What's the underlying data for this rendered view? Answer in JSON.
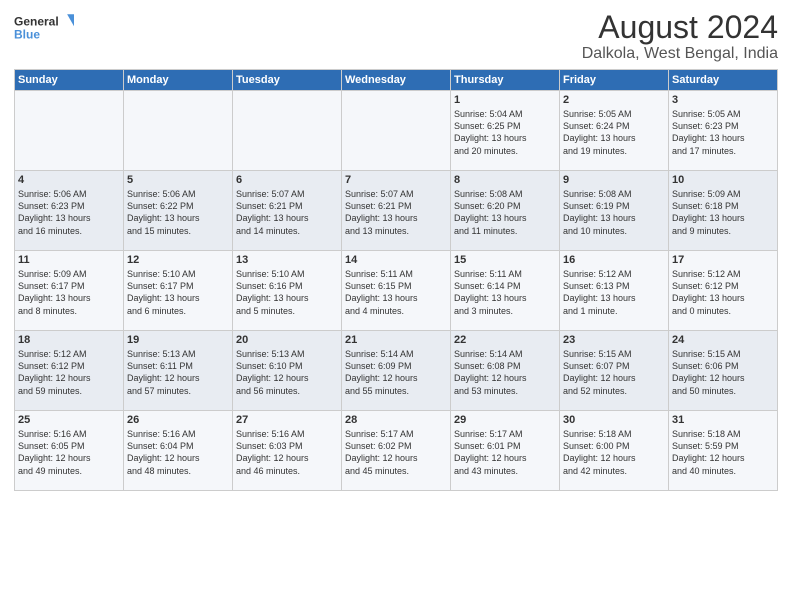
{
  "logo": {
    "line1": "General",
    "line2": "Blue"
  },
  "title": "August 2024",
  "subtitle": "Dalkola, West Bengal, India",
  "days_of_week": [
    "Sunday",
    "Monday",
    "Tuesday",
    "Wednesday",
    "Thursday",
    "Friday",
    "Saturday"
  ],
  "weeks": [
    [
      {
        "day": "",
        "text": ""
      },
      {
        "day": "",
        "text": ""
      },
      {
        "day": "",
        "text": ""
      },
      {
        "day": "",
        "text": ""
      },
      {
        "day": "1",
        "text": "Sunrise: 5:04 AM\nSunset: 6:25 PM\nDaylight: 13 hours\nand 20 minutes."
      },
      {
        "day": "2",
        "text": "Sunrise: 5:05 AM\nSunset: 6:24 PM\nDaylight: 13 hours\nand 19 minutes."
      },
      {
        "day": "3",
        "text": "Sunrise: 5:05 AM\nSunset: 6:23 PM\nDaylight: 13 hours\nand 17 minutes."
      }
    ],
    [
      {
        "day": "4",
        "text": "Sunrise: 5:06 AM\nSunset: 6:23 PM\nDaylight: 13 hours\nand 16 minutes."
      },
      {
        "day": "5",
        "text": "Sunrise: 5:06 AM\nSunset: 6:22 PM\nDaylight: 13 hours\nand 15 minutes."
      },
      {
        "day": "6",
        "text": "Sunrise: 5:07 AM\nSunset: 6:21 PM\nDaylight: 13 hours\nand 14 minutes."
      },
      {
        "day": "7",
        "text": "Sunrise: 5:07 AM\nSunset: 6:21 PM\nDaylight: 13 hours\nand 13 minutes."
      },
      {
        "day": "8",
        "text": "Sunrise: 5:08 AM\nSunset: 6:20 PM\nDaylight: 13 hours\nand 11 minutes."
      },
      {
        "day": "9",
        "text": "Sunrise: 5:08 AM\nSunset: 6:19 PM\nDaylight: 13 hours\nand 10 minutes."
      },
      {
        "day": "10",
        "text": "Sunrise: 5:09 AM\nSunset: 6:18 PM\nDaylight: 13 hours\nand 9 minutes."
      }
    ],
    [
      {
        "day": "11",
        "text": "Sunrise: 5:09 AM\nSunset: 6:17 PM\nDaylight: 13 hours\nand 8 minutes."
      },
      {
        "day": "12",
        "text": "Sunrise: 5:10 AM\nSunset: 6:17 PM\nDaylight: 13 hours\nand 6 minutes."
      },
      {
        "day": "13",
        "text": "Sunrise: 5:10 AM\nSunset: 6:16 PM\nDaylight: 13 hours\nand 5 minutes."
      },
      {
        "day": "14",
        "text": "Sunrise: 5:11 AM\nSunset: 6:15 PM\nDaylight: 13 hours\nand 4 minutes."
      },
      {
        "day": "15",
        "text": "Sunrise: 5:11 AM\nSunset: 6:14 PM\nDaylight: 13 hours\nand 3 minutes."
      },
      {
        "day": "16",
        "text": "Sunrise: 5:12 AM\nSunset: 6:13 PM\nDaylight: 13 hours\nand 1 minute."
      },
      {
        "day": "17",
        "text": "Sunrise: 5:12 AM\nSunset: 6:12 PM\nDaylight: 13 hours\nand 0 minutes."
      }
    ],
    [
      {
        "day": "18",
        "text": "Sunrise: 5:12 AM\nSunset: 6:12 PM\nDaylight: 12 hours\nand 59 minutes."
      },
      {
        "day": "19",
        "text": "Sunrise: 5:13 AM\nSunset: 6:11 PM\nDaylight: 12 hours\nand 57 minutes."
      },
      {
        "day": "20",
        "text": "Sunrise: 5:13 AM\nSunset: 6:10 PM\nDaylight: 12 hours\nand 56 minutes."
      },
      {
        "day": "21",
        "text": "Sunrise: 5:14 AM\nSunset: 6:09 PM\nDaylight: 12 hours\nand 55 minutes."
      },
      {
        "day": "22",
        "text": "Sunrise: 5:14 AM\nSunset: 6:08 PM\nDaylight: 12 hours\nand 53 minutes."
      },
      {
        "day": "23",
        "text": "Sunrise: 5:15 AM\nSunset: 6:07 PM\nDaylight: 12 hours\nand 52 minutes."
      },
      {
        "day": "24",
        "text": "Sunrise: 5:15 AM\nSunset: 6:06 PM\nDaylight: 12 hours\nand 50 minutes."
      }
    ],
    [
      {
        "day": "25",
        "text": "Sunrise: 5:16 AM\nSunset: 6:05 PM\nDaylight: 12 hours\nand 49 minutes."
      },
      {
        "day": "26",
        "text": "Sunrise: 5:16 AM\nSunset: 6:04 PM\nDaylight: 12 hours\nand 48 minutes."
      },
      {
        "day": "27",
        "text": "Sunrise: 5:16 AM\nSunset: 6:03 PM\nDaylight: 12 hours\nand 46 minutes."
      },
      {
        "day": "28",
        "text": "Sunrise: 5:17 AM\nSunset: 6:02 PM\nDaylight: 12 hours\nand 45 minutes."
      },
      {
        "day": "29",
        "text": "Sunrise: 5:17 AM\nSunset: 6:01 PM\nDaylight: 12 hours\nand 43 minutes."
      },
      {
        "day": "30",
        "text": "Sunrise: 5:18 AM\nSunset: 6:00 PM\nDaylight: 12 hours\nand 42 minutes."
      },
      {
        "day": "31",
        "text": "Sunrise: 5:18 AM\nSunset: 5:59 PM\nDaylight: 12 hours\nand 40 minutes."
      }
    ]
  ]
}
